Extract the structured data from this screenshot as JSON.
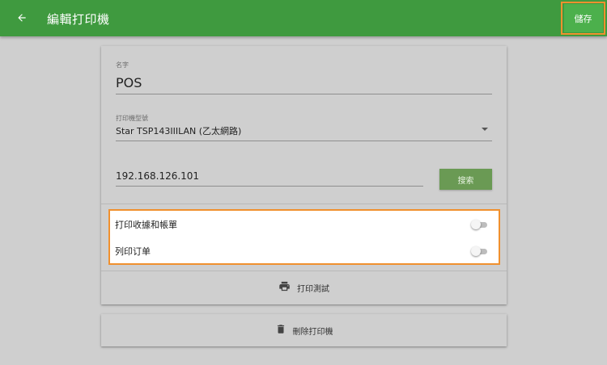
{
  "appbar": {
    "title": "編輯打印機",
    "save_label": "儲存",
    "back_icon": "arrow-left-icon",
    "color": "#3f9a3f"
  },
  "form": {
    "name_label": "名字",
    "name_value": "POS",
    "model_label": "打印機型號",
    "model_value": "Star TSP143IIILAN (乙太網路)",
    "ip_value": "192.168.126.101",
    "search_label": "搜索"
  },
  "toggles": [
    {
      "label": "打印收據和帳單",
      "on": false
    },
    {
      "label": "列印订单",
      "on": false
    }
  ],
  "actions": {
    "print_test_label": "打印測試",
    "print_test_icon": "printer-icon",
    "delete_label": "刪除打印機",
    "delete_icon": "trash-icon"
  },
  "colors": {
    "accent": "#3f9a3f",
    "highlight": "#f0902e",
    "search_button": "#6a9a54"
  }
}
